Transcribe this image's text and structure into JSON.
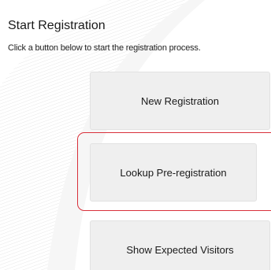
{
  "header": {
    "title": "Start Registration",
    "subtitle": "Click a button below to start the registration process."
  },
  "buttons": {
    "new_registration": "New Registration",
    "lookup_preregistration": "Lookup Pre-registration",
    "show_expected_visitors": "Show Expected Visitors"
  },
  "colors": {
    "button_bg": "#efefef",
    "focus_ring": "#d9303a",
    "background": "#ffffff"
  }
}
